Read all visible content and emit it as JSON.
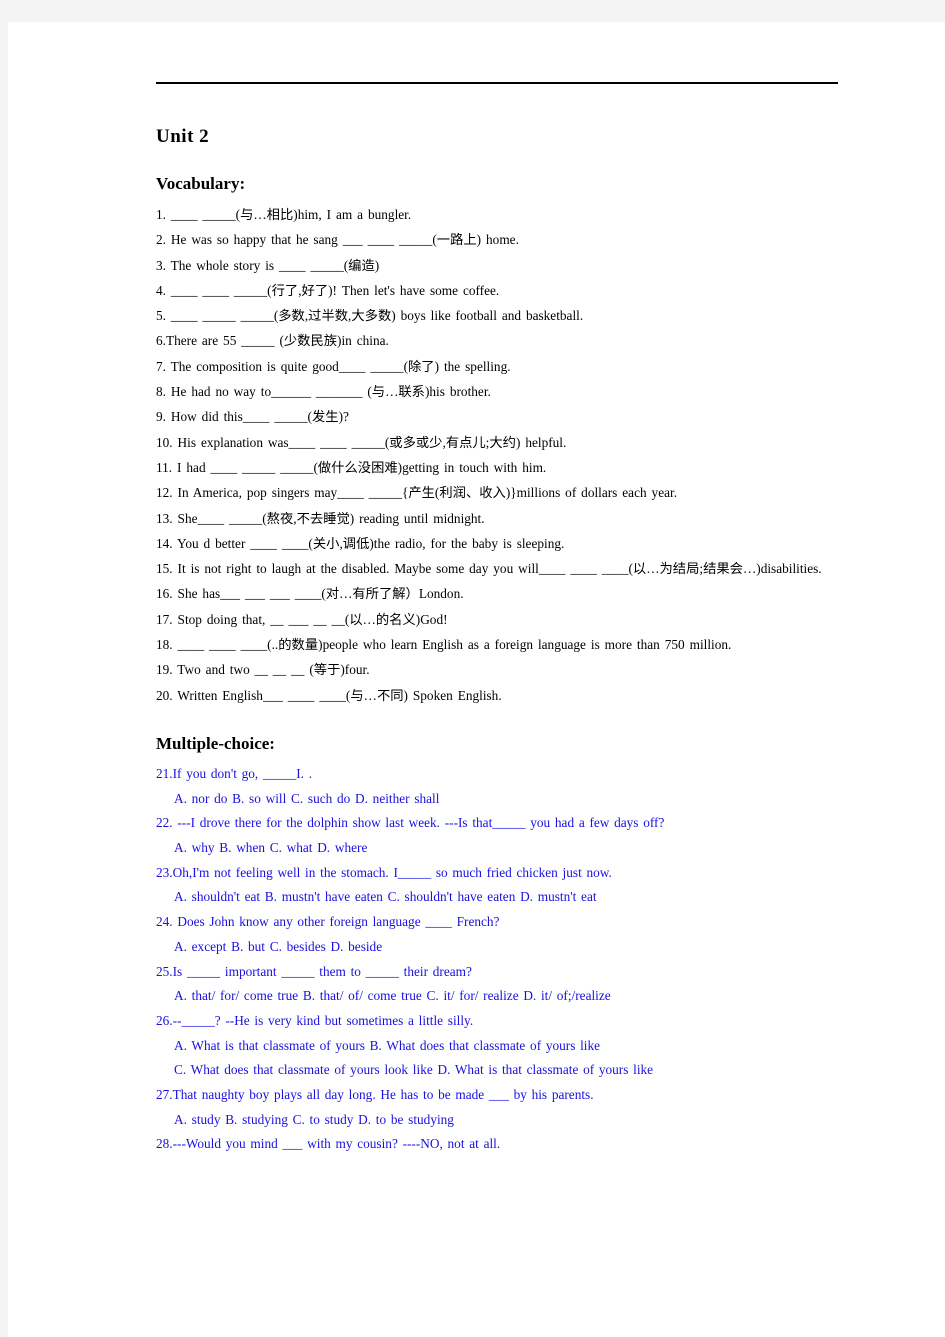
{
  "document": {
    "unit_title": "Unit 2",
    "sections": [
      {
        "heading": "Vocabulary:",
        "items": [
          "1.  ____  _____(与…相比)him, I am a bungler.",
          "2. He was so happy that he sang ___ ____ _____(一路上) home.",
          "3. The whole story is ____ _____(编造)",
          "4. ____  ____  _____(行了,好了)! Then let's have some coffee.",
          "5. ____  _____  _____(多数,过半数,大多数) boys like football and basketball.",
          "6.There are 55 _____ (少数民族)in china.",
          "7. The composition is quite good____ _____(除了) the spelling.",
          "8. He had no way to______ _______ (与…联系)his brother.",
          "9. How did this____ _____(发生)?",
          "10. His explanation was____ ____ _____(或多或少,有点儿;大约) helpful.",
          "11. I had ____ _____ _____(做什么没困难)getting in touch with him.",
          "12. In America, pop singers may____ _____{产生(利润、收入)}millions of dollars each year.",
          "13. She____ _____(熬夜,不去睡觉) reading until midnight.",
          "14. You d better ____ ____(关小,调低)the radio, for the baby is sleeping.",
          "15. It is not right to laugh at the disabled. Maybe some day you will____ ____ ____(以…为结局;结果会…)disabilities.",
          "16. She has___ ___ ___ ____(对…有所了解）London.",
          "17. Stop doing that, __ ___ __ __(以…的名义)God!",
          "18.  ____ ____ ____(..的数量)people who learn English as a foreign language is more than 750 million.",
          "19. Two and two __ __ __ (等于)four.",
          "20. Written English___ ____ ____(与…不同) Spoken English."
        ]
      }
    ],
    "multiple_choice": {
      "heading": "Multiple-choice:",
      "questions": [
        {
          "stem": "21.If you don't go, _____I. .",
          "options": "A. nor do         B. so will         C. such do        D. neither shall"
        },
        {
          "stem": "22. ---I drove there for the dolphin show last week.      ---Is that_____ you had a few days off?",
          "options": "A. why        B. when        C. what        D. where"
        },
        {
          "stem": "23.Oh,I'm not feeling well in the stomach. I_____ so much fried chicken just now.",
          "options": "A. shouldn't eat     B. mustn't have eaten      C. shouldn't have eaten       D. mustn't eat"
        },
        {
          "stem": "24. Does John know any other foreign language ____  French?",
          "options": "A. except     B. but      C. besides       D. beside"
        },
        {
          "stem": "25.Is _____ important _____ them to _____ their dream?",
          "options": "A. that/ for/ come true       B. that/ of/ come true      C. it/ for/ realize       D. it/ of;/realize"
        },
        {
          "stem": "26.--_____?     --He is very kind but sometimes a little silly.",
          "options_line1": "A. What is that classmate of yours        B. What does that classmate of yours like",
          "options_line2": "C. What does that classmate of yours look like       D. What is that classmate of yours like"
        },
        {
          "stem": "27.That naughty boy plays all day long. He has to be made ___ by his parents.",
          "options": "A. study      B. studying      C. to study      D. to be studying"
        },
        {
          "stem": "28.---Would you mind ___ with my cousin?        ----NO, not at all.",
          "options": ""
        }
      ]
    }
  },
  "colors": {
    "text": "#000000",
    "mc_text": "#1a10e0",
    "page_background": "#ffffff",
    "canvas_background": "#f4f4f4",
    "rule": "#000000"
  }
}
